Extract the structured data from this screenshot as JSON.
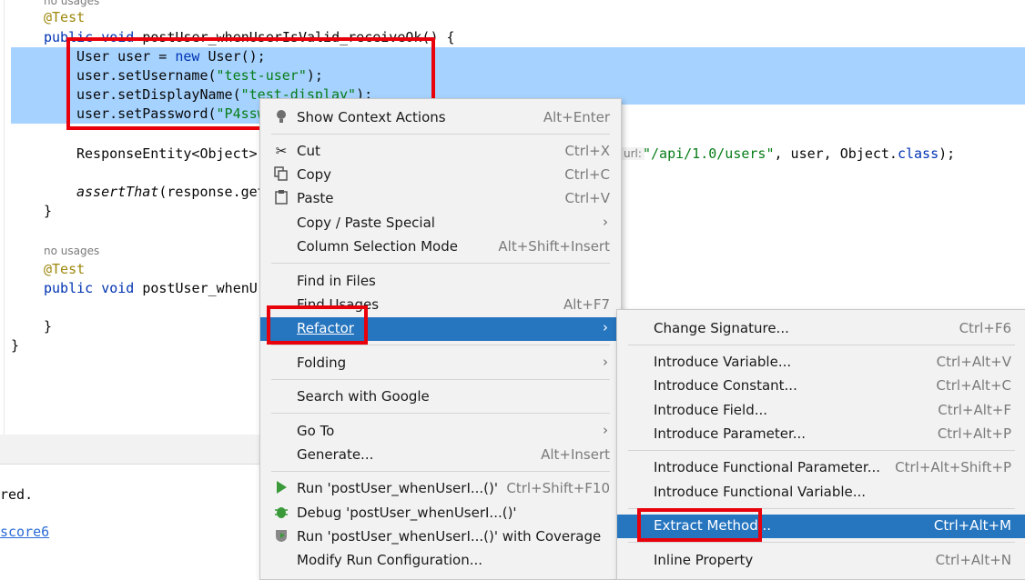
{
  "editor": {
    "usage_hint_1": "no usages",
    "annotation_1": "@Test",
    "method_sig_1_kw": "public void ",
    "method_sig_1_name": "postUser_whenUserIsValid_receiveOk",
    "method_sig_1_tail": "() {",
    "line_user_a": "User user = ",
    "line_user_new": "new",
    "line_user_b": " User();",
    "line_setusername_a": "user.setUsername(",
    "line_setusername_str": "\"test-user\"",
    "line_setusername_b": ");",
    "line_setdisplay_a": "user.setDisplayName(",
    "line_setdisplay_str": "\"test-display\"",
    "line_setdisplay_b": ");",
    "line_setpassword_a": "user.setPassword(",
    "line_setpassword_str": "\"P4ssw",
    "line_response_a": "ResponseEntity<Object>",
    "line_response_hint": "url:",
    "line_response_str": "\"/api/1.0/users\"",
    "line_response_b": ", user, Object.",
    "line_response_kw": "class",
    "line_response_c": ");",
    "line_assert_fn": "assertThat",
    "line_assert_b": "(response.get",
    "close_brace_1": "}",
    "usage_hint_2": "no usages",
    "annotation_2": "@Test",
    "method_sig_2_kw": "public void ",
    "method_sig_2_name": "postUser_whenU",
    "close_brace_2": "}",
    "close_brace_3": "}"
  },
  "bottom_panel": {
    "text_1": "red.",
    "link_1": "score6"
  },
  "context_menu": {
    "items": [
      {
        "label": "Show Context Actions",
        "shortcut": "Alt+Enter"
      },
      {
        "label": "Cut",
        "shortcut": "Ctrl+X"
      },
      {
        "label": "Copy",
        "shortcut": "Ctrl+C"
      },
      {
        "label": "Paste",
        "shortcut": "Ctrl+V"
      },
      {
        "label": "Copy / Paste Special"
      },
      {
        "label": "Column Selection Mode",
        "shortcut": "Alt+Shift+Insert"
      },
      {
        "label": "Find in Files"
      },
      {
        "label": "Find Usages",
        "shortcut": "Alt+F7"
      },
      {
        "label": "Refactor"
      },
      {
        "label": "Folding"
      },
      {
        "label": "Search with Google"
      },
      {
        "label": "Go To"
      },
      {
        "label": "Generate...",
        "shortcut": "Alt+Insert"
      },
      {
        "label": "Run 'postUser_whenUserI...()'",
        "shortcut": "Ctrl+Shift+F10"
      },
      {
        "label": "Debug 'postUser_whenUserI...()'"
      },
      {
        "label": "Run 'postUser_whenUserI...()' with Coverage"
      },
      {
        "label": "Modify Run Configuration..."
      }
    ]
  },
  "refactor_submenu": {
    "items": [
      {
        "label": "Change Signature...",
        "shortcut": "Ctrl+F6"
      },
      {
        "label": "Introduce Variable...",
        "shortcut": "Ctrl+Alt+V"
      },
      {
        "label": "Introduce Constant...",
        "shortcut": "Ctrl+Alt+C"
      },
      {
        "label": "Introduce Field...",
        "shortcut": "Ctrl+Alt+F"
      },
      {
        "label": "Introduce Parameter...",
        "shortcut": "Ctrl+Alt+P"
      },
      {
        "label": "Introduce Functional Parameter...",
        "shortcut": "Ctrl+Alt+Shift+P"
      },
      {
        "label": "Introduce Functional Variable..."
      },
      {
        "label": "Extract Method...",
        "shortcut": "Ctrl+Alt+M"
      },
      {
        "label": "Inline Property",
        "shortcut": "Ctrl+Alt+N"
      }
    ]
  },
  "colors": {
    "selection": "#a6d2ff",
    "menu_active": "#2675bf",
    "highlight_box": "#e8000b",
    "keyword": "#0033b3",
    "string": "#067d17",
    "annotation": "#9e880d"
  },
  "icons": {
    "show_context_actions": "lightbulb-icon",
    "cut": "scissors-icon",
    "copy": "copy-icon",
    "paste": "paste-icon",
    "run": "run-icon",
    "debug": "bug-icon",
    "coverage": "coverage-shield-icon",
    "submenu": "chevron-right-icon"
  }
}
